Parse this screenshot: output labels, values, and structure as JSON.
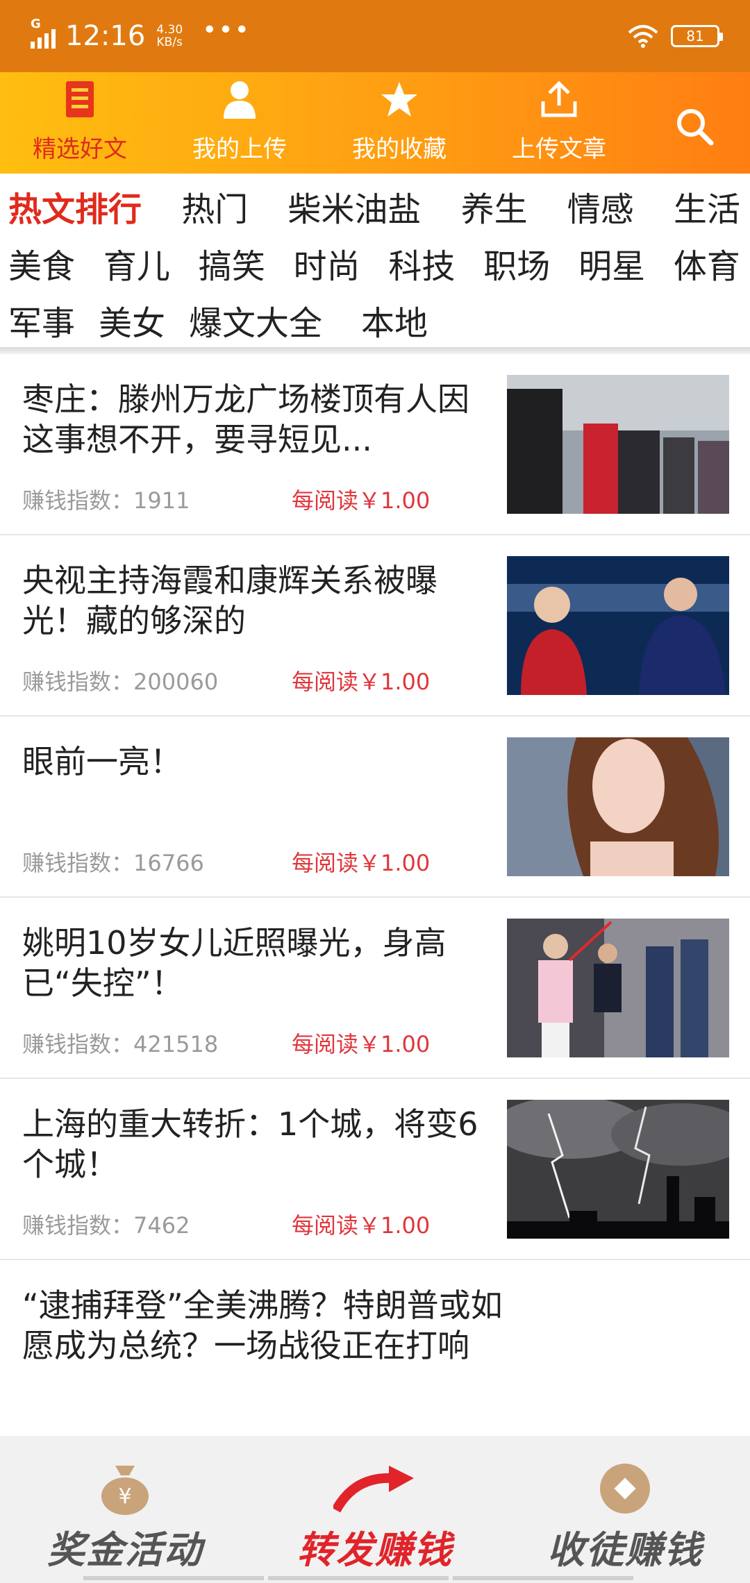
{
  "status": {
    "network": "G",
    "time": "12:16",
    "speed_value": "4.30",
    "speed_unit": "KB/s",
    "more": "•••",
    "battery": "81"
  },
  "nav": {
    "items": [
      {
        "label": "精选好文",
        "icon": "document-icon",
        "active": true
      },
      {
        "label": "我的上传",
        "icon": "user-icon"
      },
      {
        "label": "我的收藏",
        "icon": "star-icon"
      },
      {
        "label": "上传文章",
        "icon": "upload-icon"
      }
    ],
    "search_icon": "search-icon",
    "accent": "#e02a1c"
  },
  "categories": {
    "rows": [
      [
        "热文排行",
        "热门",
        "柴米油盐",
        "养生",
        "情感",
        "生活"
      ],
      [
        "美食",
        "育儿",
        "搞笑",
        "时尚",
        "科技",
        "职场",
        "明星",
        "体育"
      ],
      [
        "军事",
        "美女",
        "爆文大全",
        "本地"
      ]
    ],
    "active": "热文排行"
  },
  "articles": [
    {
      "title": "枣庄：滕州万龙广场楼顶有人因这事想不开，要寻短见...",
      "index_label": "赚钱指数：",
      "index_value": "1911",
      "price": "每阅读￥1.00"
    },
    {
      "title": "央视主持海霞和康辉关系被曝光！藏的够深的",
      "index_label": "赚钱指数：",
      "index_value": "200060",
      "price": "每阅读￥1.00"
    },
    {
      "title": "眼前一亮！",
      "index_label": "赚钱指数：",
      "index_value": "16766",
      "price": "每阅读￥1.00"
    },
    {
      "title": "姚明10岁女儿近照曝光，身高已“失控”！",
      "index_label": "赚钱指数：",
      "index_value": "421518",
      "price": "每阅读￥1.00"
    },
    {
      "title": "上海的重大转折：1个城，将变6个城！",
      "index_label": "赚钱指数：",
      "index_value": "7462",
      "price": "每阅读￥1.00"
    },
    {
      "title": "“逮捕拜登”全美沸腾？特朗普或如愿成为总统？一场战役正在打响"
    }
  ],
  "bottom": {
    "items": [
      {
        "label": "奖金活动",
        "icon": "money-bag-icon"
      },
      {
        "label": "转发赚钱",
        "icon": "share-arrow-icon"
      },
      {
        "label": "收徒赚钱",
        "icon": "coin-icon"
      }
    ]
  }
}
